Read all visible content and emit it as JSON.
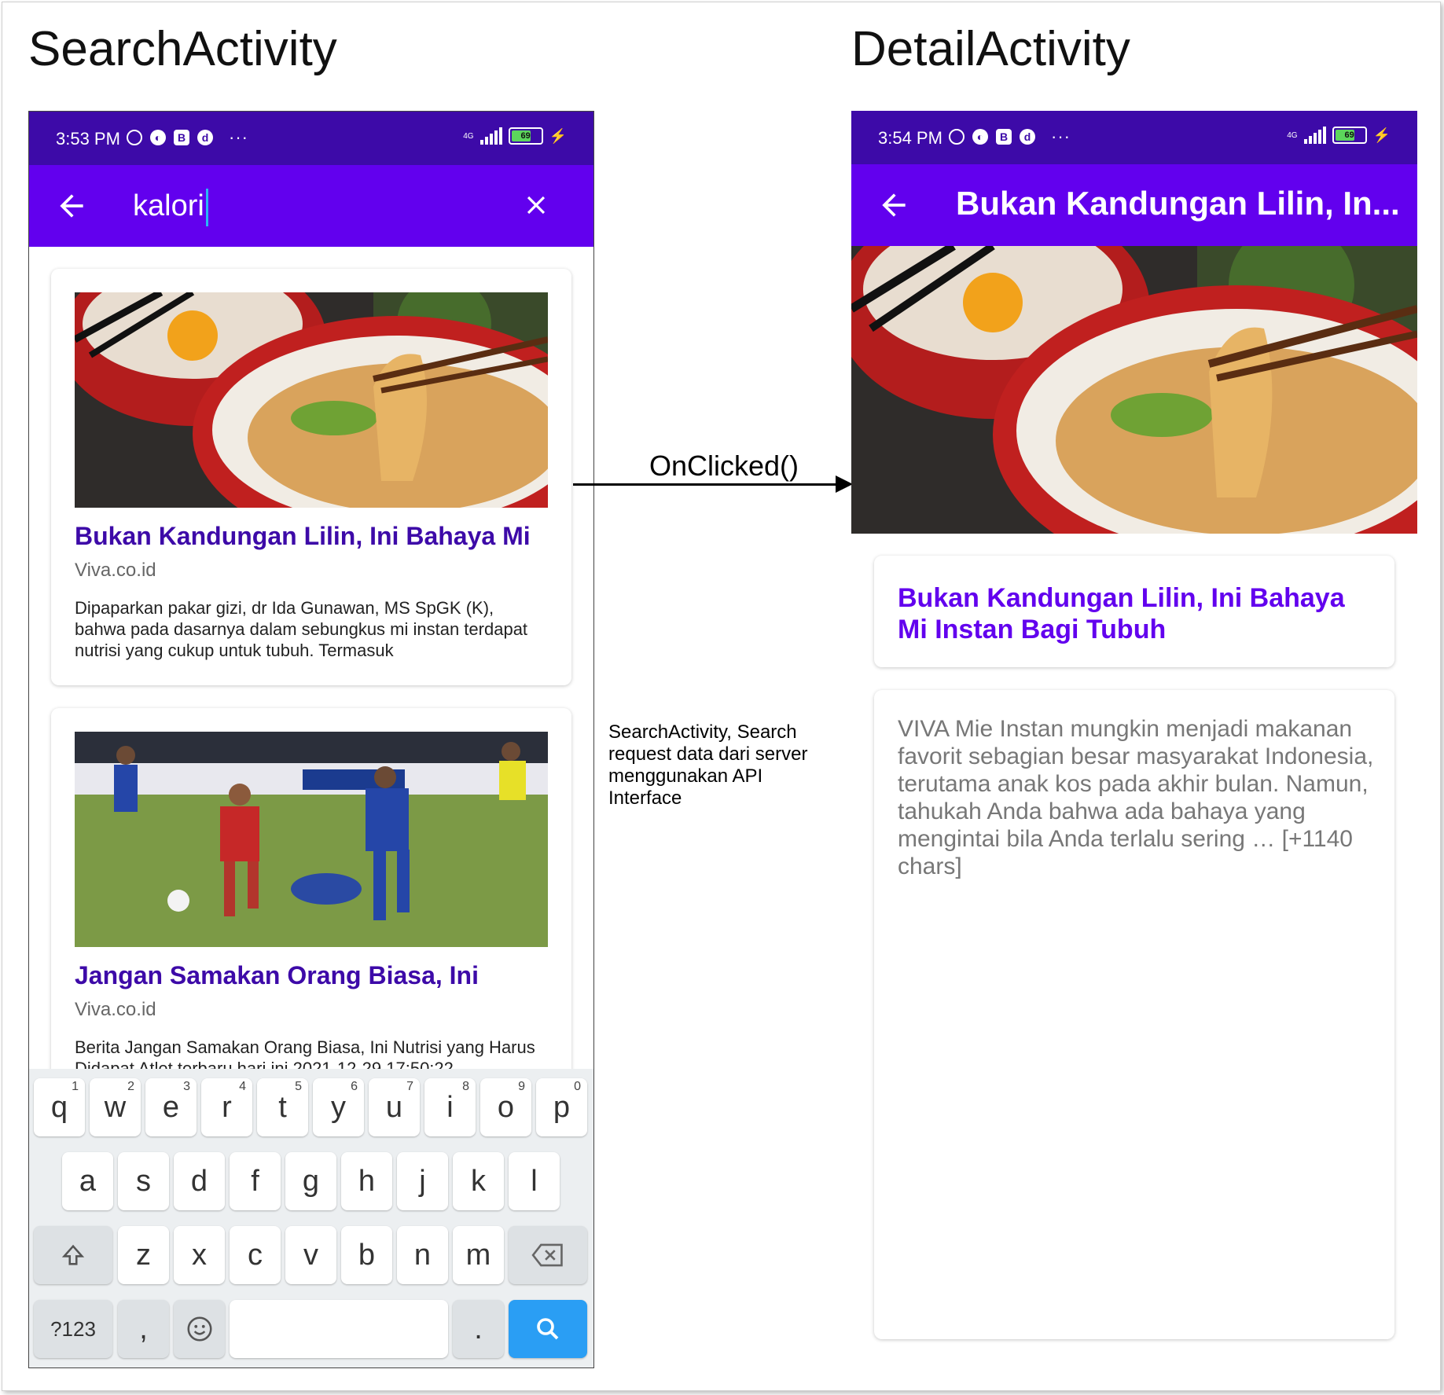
{
  "headings": {
    "left": "SearchActivity",
    "right": "DetailActivity"
  },
  "left_phone": {
    "status": {
      "time": "3:53 PM",
      "network": "4G",
      "battery": "69"
    },
    "search": {
      "query": "kalori"
    },
    "results": [
      {
        "title": "Bukan Kandungan Lilin, Ini Bahaya Mi",
        "source": "Viva.co.id",
        "description": "Dipaparkan pakar gizi, dr Ida Gunawan, MS SpGK (K), bahwa pada dasarnya dalam sebungkus mi instan terdapat nutrisi yang cukup untuk tubuh. Termasuk",
        "image": "noodle-bowl-photo"
      },
      {
        "title": "Jangan Samakan Orang Biasa, Ini",
        "source": "Viva.co.id",
        "description": "Berita Jangan Samakan Orang Biasa, Ini Nutrisi yang Harus Didapat Atlet terbaru hari ini 2021-12-29 17:50:22",
        "image": "football-match-photo"
      }
    ],
    "keyboard": {
      "row1": [
        [
          "q",
          "1"
        ],
        [
          "w",
          "2"
        ],
        [
          "e",
          "3"
        ],
        [
          "r",
          "4"
        ],
        [
          "t",
          "5"
        ],
        [
          "y",
          "6"
        ],
        [
          "u",
          "7"
        ],
        [
          "i",
          "8"
        ],
        [
          "o",
          "9"
        ],
        [
          "p",
          "0"
        ]
      ],
      "row2": [
        "a",
        "s",
        "d",
        "f",
        "g",
        "h",
        "j",
        "k",
        "l"
      ],
      "row3": [
        "z",
        "x",
        "c",
        "v",
        "b",
        "n",
        "m"
      ],
      "symbols_label": "?123",
      "comma": ",",
      "period": "."
    }
  },
  "arrow": {
    "label": "OnClicked()"
  },
  "note": "SearchActivity, Search request data dari server menggunakan API Interface",
  "right_phone": {
    "status": {
      "time": "3:54 PM",
      "network": "4G",
      "battery": "69"
    },
    "appbar_title": "Bukan Kandungan Lilin, In...",
    "image": "noodle-bowl-photo",
    "article_title": "Bukan Kandungan Lilin, Ini Bahaya Mi Instan Bagi Tubuh",
    "article_body": "VIVA  Mie Instan mungkin menjadi makanan favorit sebagian besar masyarakat Indonesia, terutama anak kos pada akhir bulan. Namun, tahukah Anda bahwa ada bahaya yang mengintai bila Anda terlalu sering … [+1140 chars]"
  },
  "colors": {
    "status_bar": "#3d0aa8",
    "app_bar": "#6200ee",
    "title_text": "#3d0aa8",
    "search_key": "#2a9ef4"
  }
}
